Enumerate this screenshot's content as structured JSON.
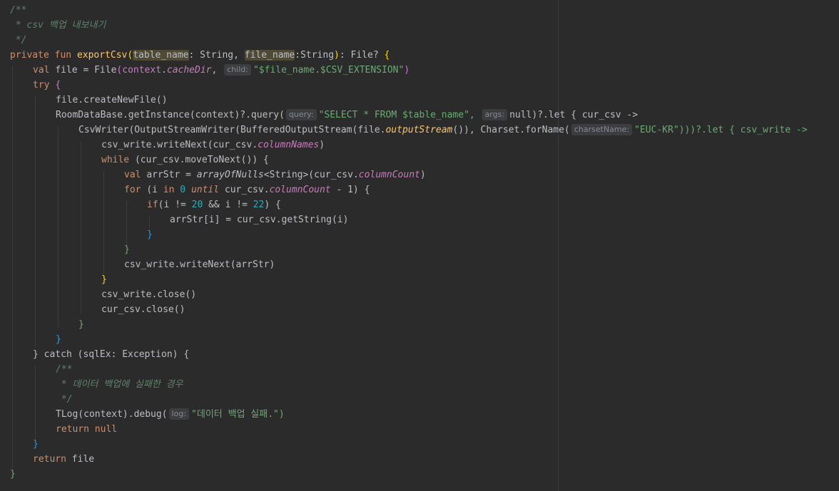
{
  "editor": {
    "lines": [
      [
        "/**"
      ],
      [
        " * csv 백업 내보내기"
      ],
      [
        " */"
      ],
      [
        "private",
        "fun",
        "exportCsv",
        "table_name",
        "String",
        "file_name",
        "String",
        "File?"
      ],
      [
        "val",
        "file",
        "File",
        "context",
        "cacheDir",
        "child:",
        "\"$file_name.$CSV_EXTENSION\""
      ],
      [
        "try"
      ],
      [
        "file.createNewFile()"
      ],
      [
        "RoomDataBase.getInstance(context)?.query(",
        "query:",
        "\"SELECT * FROM $table_name\",",
        "args:",
        "null)?.let { cur_csv ->"
      ],
      [
        "CsvWriter(OutputStreamWriter(BufferedOutputStream(file.",
        "outputStream",
        "()), Charset.forName(",
        "charsetName:",
        "\"EUC-KR\")))?.let { csv_write ->"
      ],
      [
        "csv_write.writeNext(cur_csv.",
        "columnNames",
        ")"
      ],
      [
        "while",
        "(cur_csv.moveToNext()) {"
      ],
      [
        "val",
        "arrStr = ",
        "arrayOfNulls",
        "<String>(cur_csv.",
        "columnCount",
        ")"
      ],
      [
        "for",
        "(i",
        "in",
        "0",
        "until",
        "cur_csv.",
        "columnCount",
        "- 1) {"
      ],
      [
        "if",
        "(i != ",
        "20",
        "&& i != ",
        "22",
        ") {"
      ],
      [
        "arrStr[i] = cur_csv.getString(i)"
      ],
      [
        "}"
      ],
      [
        "}"
      ],
      [
        "csv_write.writeNext(arrStr)"
      ],
      [
        "}"
      ],
      [
        "csv_write.close()"
      ],
      [
        "cur_csv.close()"
      ],
      [
        "}"
      ],
      [
        "}"
      ],
      [
        "} catch (sqlEx: Exception) {"
      ],
      [
        "/**"
      ],
      [
        " * 데이터 백업에 실패한 경우"
      ],
      [
        " */"
      ],
      [
        "TLog(context).debug(",
        "log:",
        "\"데이터 백업 실패.\")"
      ],
      [
        "return",
        "null"
      ],
      [
        "}"
      ],
      [
        "return",
        "file"
      ],
      [
        "}"
      ]
    ]
  }
}
